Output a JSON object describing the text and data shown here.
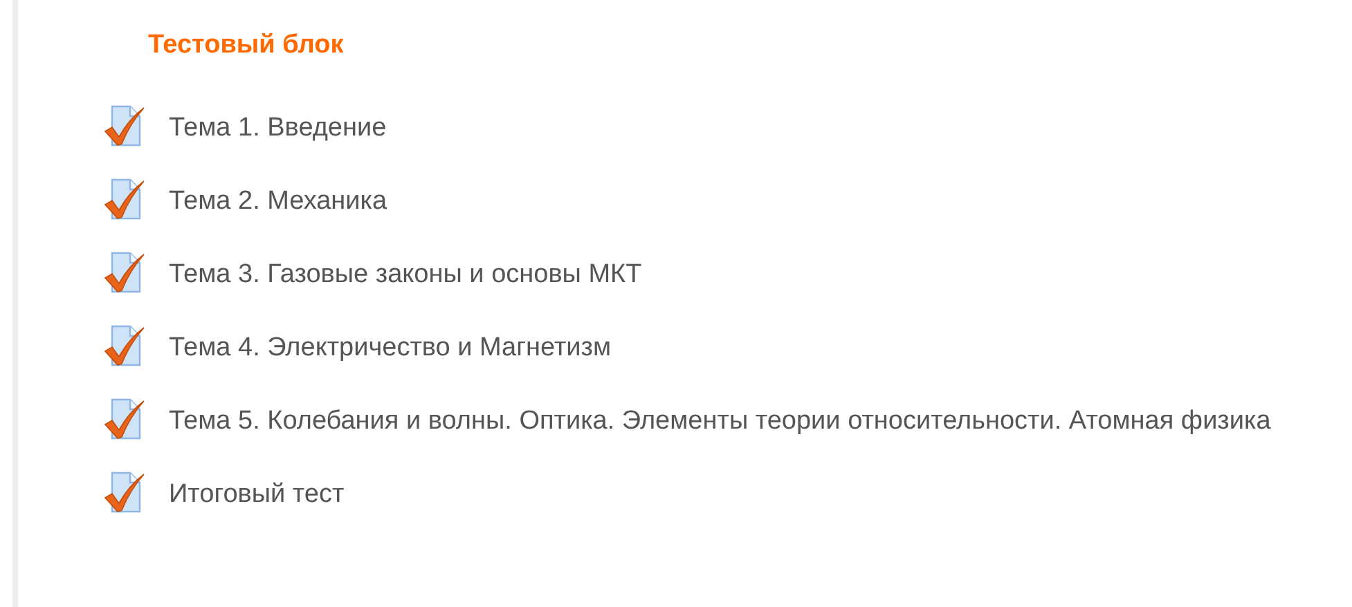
{
  "block": {
    "title": "Тестовый блок",
    "items": [
      {
        "label": "Тема 1. Введение"
      },
      {
        "label": "Тема 2. Механика"
      },
      {
        "label": "Тема 3. Газовые законы и основы МКТ"
      },
      {
        "label": "Тема 4. Электричество и Магнетизм"
      },
      {
        "label": "Тема 5. Колебания и волны. Оптика. Элементы теории относительности. Атомная физика"
      },
      {
        "label": "Итоговый тест"
      }
    ]
  }
}
